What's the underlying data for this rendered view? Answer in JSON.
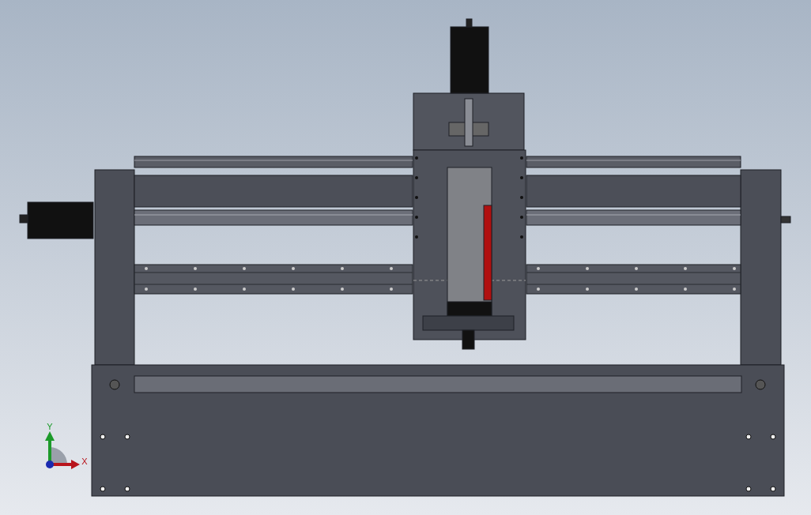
{
  "viewport": {
    "triad": {
      "axes": [
        {
          "kind": "vertical",
          "label": "Y",
          "color": "#1c9a2a"
        },
        {
          "kind": "horizontal",
          "label": "X",
          "color": "#b8141c"
        }
      ]
    }
  }
}
